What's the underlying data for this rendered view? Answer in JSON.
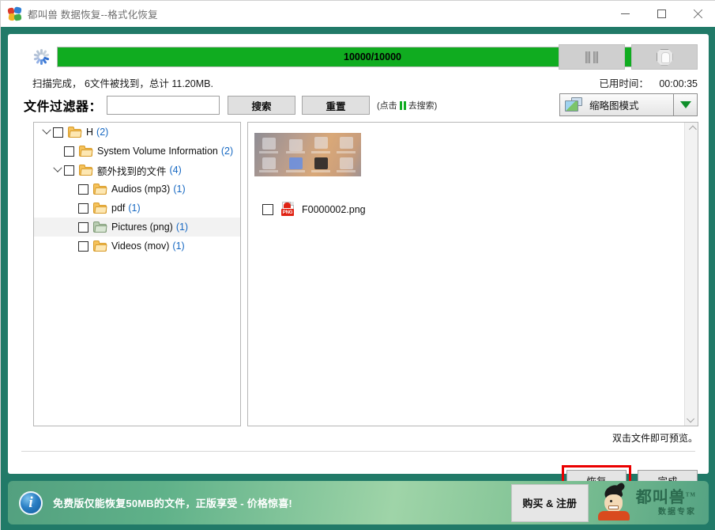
{
  "window": {
    "title": "都叫兽 数据恢复--格式化恢复",
    "app_icon": "puzzle-logo-icon",
    "minimize_label": "—",
    "maximize_label": "□",
    "close_label": "✕",
    "frame_color": "#217a68"
  },
  "scan": {
    "spinner_icon": "loading-spinner-icon",
    "progress_text": "10000/10000",
    "progress_percent": 100,
    "progress_color": "#10ac20",
    "status_text": "扫描完成，  6文件被找到，总计 11.20MB.",
    "pause_button_icon": "pause-icon",
    "stop_button_icon": "stop-hand-icon",
    "elapsed_label": "已用时间：",
    "elapsed_value": "00:00:35"
  },
  "filter": {
    "label": "文件过滤器：",
    "input_value": "",
    "input_placeholder": "",
    "search_label": "搜索",
    "reset_label": "重置",
    "hint_prefix": "(点击",
    "hint_suffix": "去搜索)",
    "hint_icon": "pause-icon"
  },
  "view_mode": {
    "icon": "photos-icon",
    "label": "缩略图模式",
    "arrow_icon": "chevron-down-icon",
    "arrow_color": "#0f8f2a",
    "options": [
      "缩略图模式"
    ]
  },
  "tree": {
    "items": [
      {
        "indent": 0,
        "expanded": true,
        "has_toggle": true,
        "checked": false,
        "folder": "yellow",
        "label": "H",
        "count": "(2)"
      },
      {
        "indent": 1,
        "expanded": false,
        "has_toggle": false,
        "checked": false,
        "folder": "yellow",
        "label": "System Volume Information",
        "count": "(2)"
      },
      {
        "indent": 1,
        "expanded": true,
        "has_toggle": true,
        "checked": false,
        "folder": "yellow",
        "label": "额外找到的文件",
        "count": "(4)"
      },
      {
        "indent": 2,
        "expanded": false,
        "has_toggle": false,
        "checked": false,
        "folder": "yellow",
        "label": "Audios (mp3)",
        "count": "(1)"
      },
      {
        "indent": 2,
        "expanded": false,
        "has_toggle": false,
        "checked": false,
        "folder": "yellow",
        "label": "pdf",
        "count": "(1)"
      },
      {
        "indent": 2,
        "expanded": false,
        "has_toggle": false,
        "checked": false,
        "folder": "green",
        "label": "Pictures (png)",
        "count": "(1)",
        "selected": true
      },
      {
        "indent": 2,
        "expanded": false,
        "has_toggle": false,
        "checked": false,
        "folder": "yellow",
        "label": "Videos (mov)",
        "count": "(1)"
      }
    ]
  },
  "file_panel": {
    "thumbnail_alt": "desktop-screenshot-thumbnail",
    "entry": {
      "checked": false,
      "icon": "png-file-icon",
      "icon_badge": "PNG",
      "name": "F0000002.png"
    },
    "scrollbar_up_icon": "chevron-up-icon",
    "scrollbar_down_icon": "chevron-down-icon"
  },
  "preview_hint": "双击文件即可预览。",
  "actions": {
    "recover_label": "恢复",
    "finish_label": "完成",
    "highlight_color": "#ea0000"
  },
  "promo": {
    "info_icon": "info-icon",
    "info_glyph": "i",
    "message": "免费版仅能恢复50MB的文件，正版享受 - 价格惊喜!",
    "buy_label": "购买 & 注册",
    "mascot_icon": "mascot-icon",
    "brand_name": "都叫兽",
    "brand_tm": "TM",
    "brand_sub": "数据专家"
  }
}
